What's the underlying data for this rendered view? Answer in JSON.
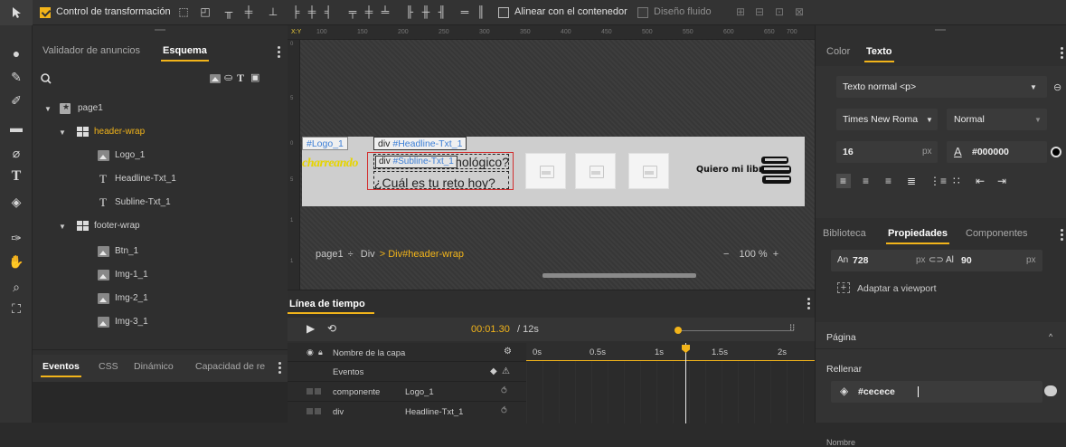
{
  "toolbar": {
    "transform_control_label": "Control de transformación",
    "align_container_label": "Alinear con el contenedor",
    "fluid_design_label": "Diseño fluido"
  },
  "left_panel": {
    "tabs": [
      "Validador de anuncios",
      "Esquema"
    ],
    "active_tab": "Esquema",
    "layers": [
      {
        "label": "page1",
        "depth": 0,
        "type": "page",
        "expanded": true
      },
      {
        "label": "header-wrap",
        "depth": 1,
        "type": "container",
        "expanded": true,
        "selected": true
      },
      {
        "label": "Logo_1",
        "depth": 2,
        "type": "image"
      },
      {
        "label": "Headline-Txt_1",
        "depth": 2,
        "type": "text"
      },
      {
        "label": "Subline-Txt_1",
        "depth": 2,
        "type": "text"
      },
      {
        "label": "footer-wrap",
        "depth": 1,
        "type": "container",
        "expanded": true
      },
      {
        "label": "Btn_1",
        "depth": 2,
        "type": "image"
      },
      {
        "label": "Img-1_1",
        "depth": 2,
        "type": "image"
      },
      {
        "label": "Img-2_1",
        "depth": 2,
        "type": "image"
      },
      {
        "label": "Img-3_1",
        "depth": 2,
        "type": "image"
      }
    ],
    "bottom_tabs": [
      "Eventos",
      "CSS",
      "Dinámico",
      "Capacidad de re"
    ],
    "bottom_active": "Eventos"
  },
  "ruler": {
    "top_marks": [
      "100",
      "150",
      "200",
      "250",
      "300",
      "350",
      "400",
      "450",
      "500",
      "550",
      "600",
      "650",
      "700"
    ]
  },
  "canvas": {
    "logo_tag": "#Logo_1",
    "headline_tag_prefix": "div",
    "headline_tag": "#Headline-Txt_1",
    "subline_tag_prefix": "div",
    "subline_tag": "#Subline-Txt_1",
    "logo_text": "charreando",
    "headline_text": "nológico?",
    "subline_text": "¿Cuál es tu reto hoy?",
    "cta_text": "Quiero mi libro",
    "page_color": "#cecece"
  },
  "breadcrumb": {
    "page": "page1",
    "sep": "÷",
    "item1": "Div",
    "arrow": ">",
    "item2": "Div#header-wrap",
    "zoom": "100 %",
    "minus": "−",
    "plus": "+"
  },
  "timeline": {
    "title": "Línea de tiempo",
    "time_current": "00:01.30",
    "time_total": "/ 12s",
    "col_layer_name": "Nombre de la capa",
    "ticks": [
      "0s",
      "0.5s",
      "1s",
      "1.5s",
      "2s"
    ],
    "rows": [
      {
        "label": "Eventos",
        "value": ""
      },
      {
        "label": "componente",
        "value": "Logo_1"
      },
      {
        "label": "div",
        "value": "Headline-Txt_1"
      }
    ]
  },
  "right_panel": {
    "tabs_top": [
      "Color",
      "Texto"
    ],
    "active_top": "Texto",
    "paragraph_style": "Texto normal <p>",
    "font_family": "Times New Roma",
    "font_weight": "Normal",
    "font_size": "16",
    "font_size_unit": "px",
    "text_color": "#000000",
    "tabs_mid": [
      "Biblioteca",
      "Propiedades",
      "Componentes"
    ],
    "active_mid": "Propiedades",
    "width_label": "An",
    "width_value": "728",
    "width_unit": "px",
    "height_label": "Al",
    "height_value": "90",
    "height_unit": "px",
    "fit_viewport": "Adaptar a viewport",
    "section_page": "Página",
    "fill_label": "Rellenar",
    "fill_value": "#cecece",
    "name_label": "Nombre"
  },
  "colors": {
    "accent": "#f2b41a",
    "selected_text": "#f2b41a",
    "link": "#4f8fdc"
  }
}
